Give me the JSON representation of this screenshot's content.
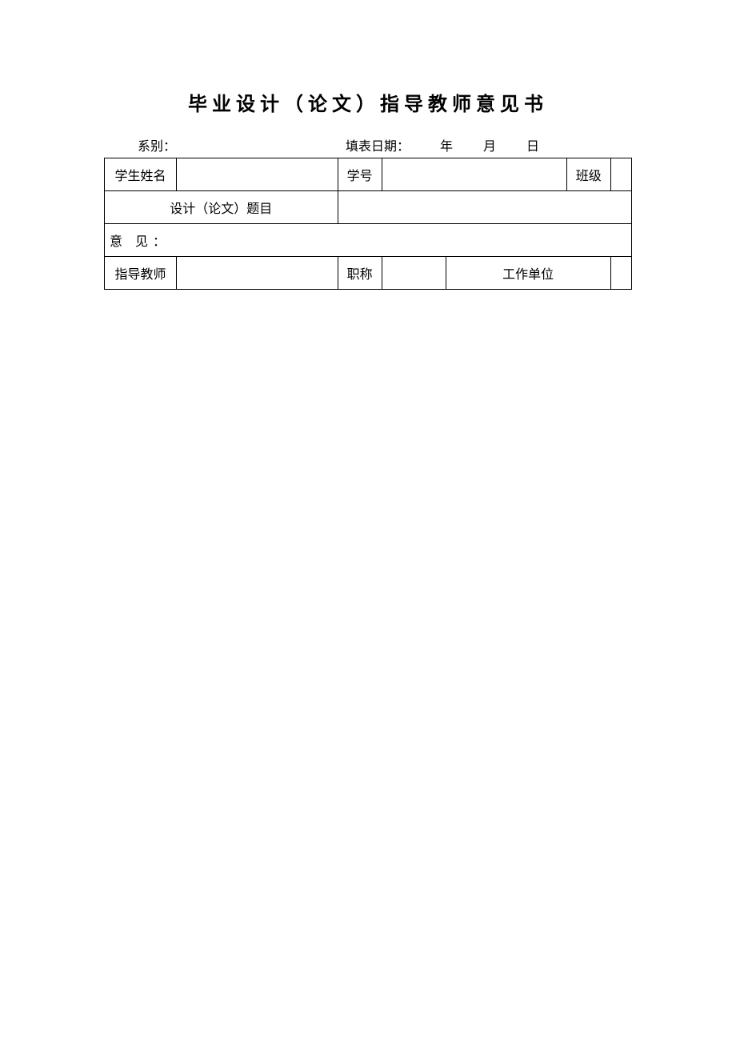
{
  "title": "毕业设计（论文）指导教师意见书",
  "meta": {
    "department_label": "系别：",
    "department_value": "",
    "date_label": "填表日期：",
    "year_value": "",
    "year_unit": "年",
    "month_value": "",
    "month_unit": "月",
    "day_value": "",
    "day_unit": "日"
  },
  "row1": {
    "name_label": "学生姓名",
    "name_value": "",
    "id_label": "学号",
    "id_value": "",
    "class_label": "班级",
    "class_value": ""
  },
  "row2": {
    "title_label": "设计（论文）题目",
    "title_value": ""
  },
  "comments": {
    "label": "意 见：",
    "value": ""
  },
  "row4": {
    "advisor_label": "指导教师",
    "advisor_value": "",
    "title_label": "职称",
    "title_value": "",
    "unit_label": "工作单位",
    "unit_value": ""
  }
}
